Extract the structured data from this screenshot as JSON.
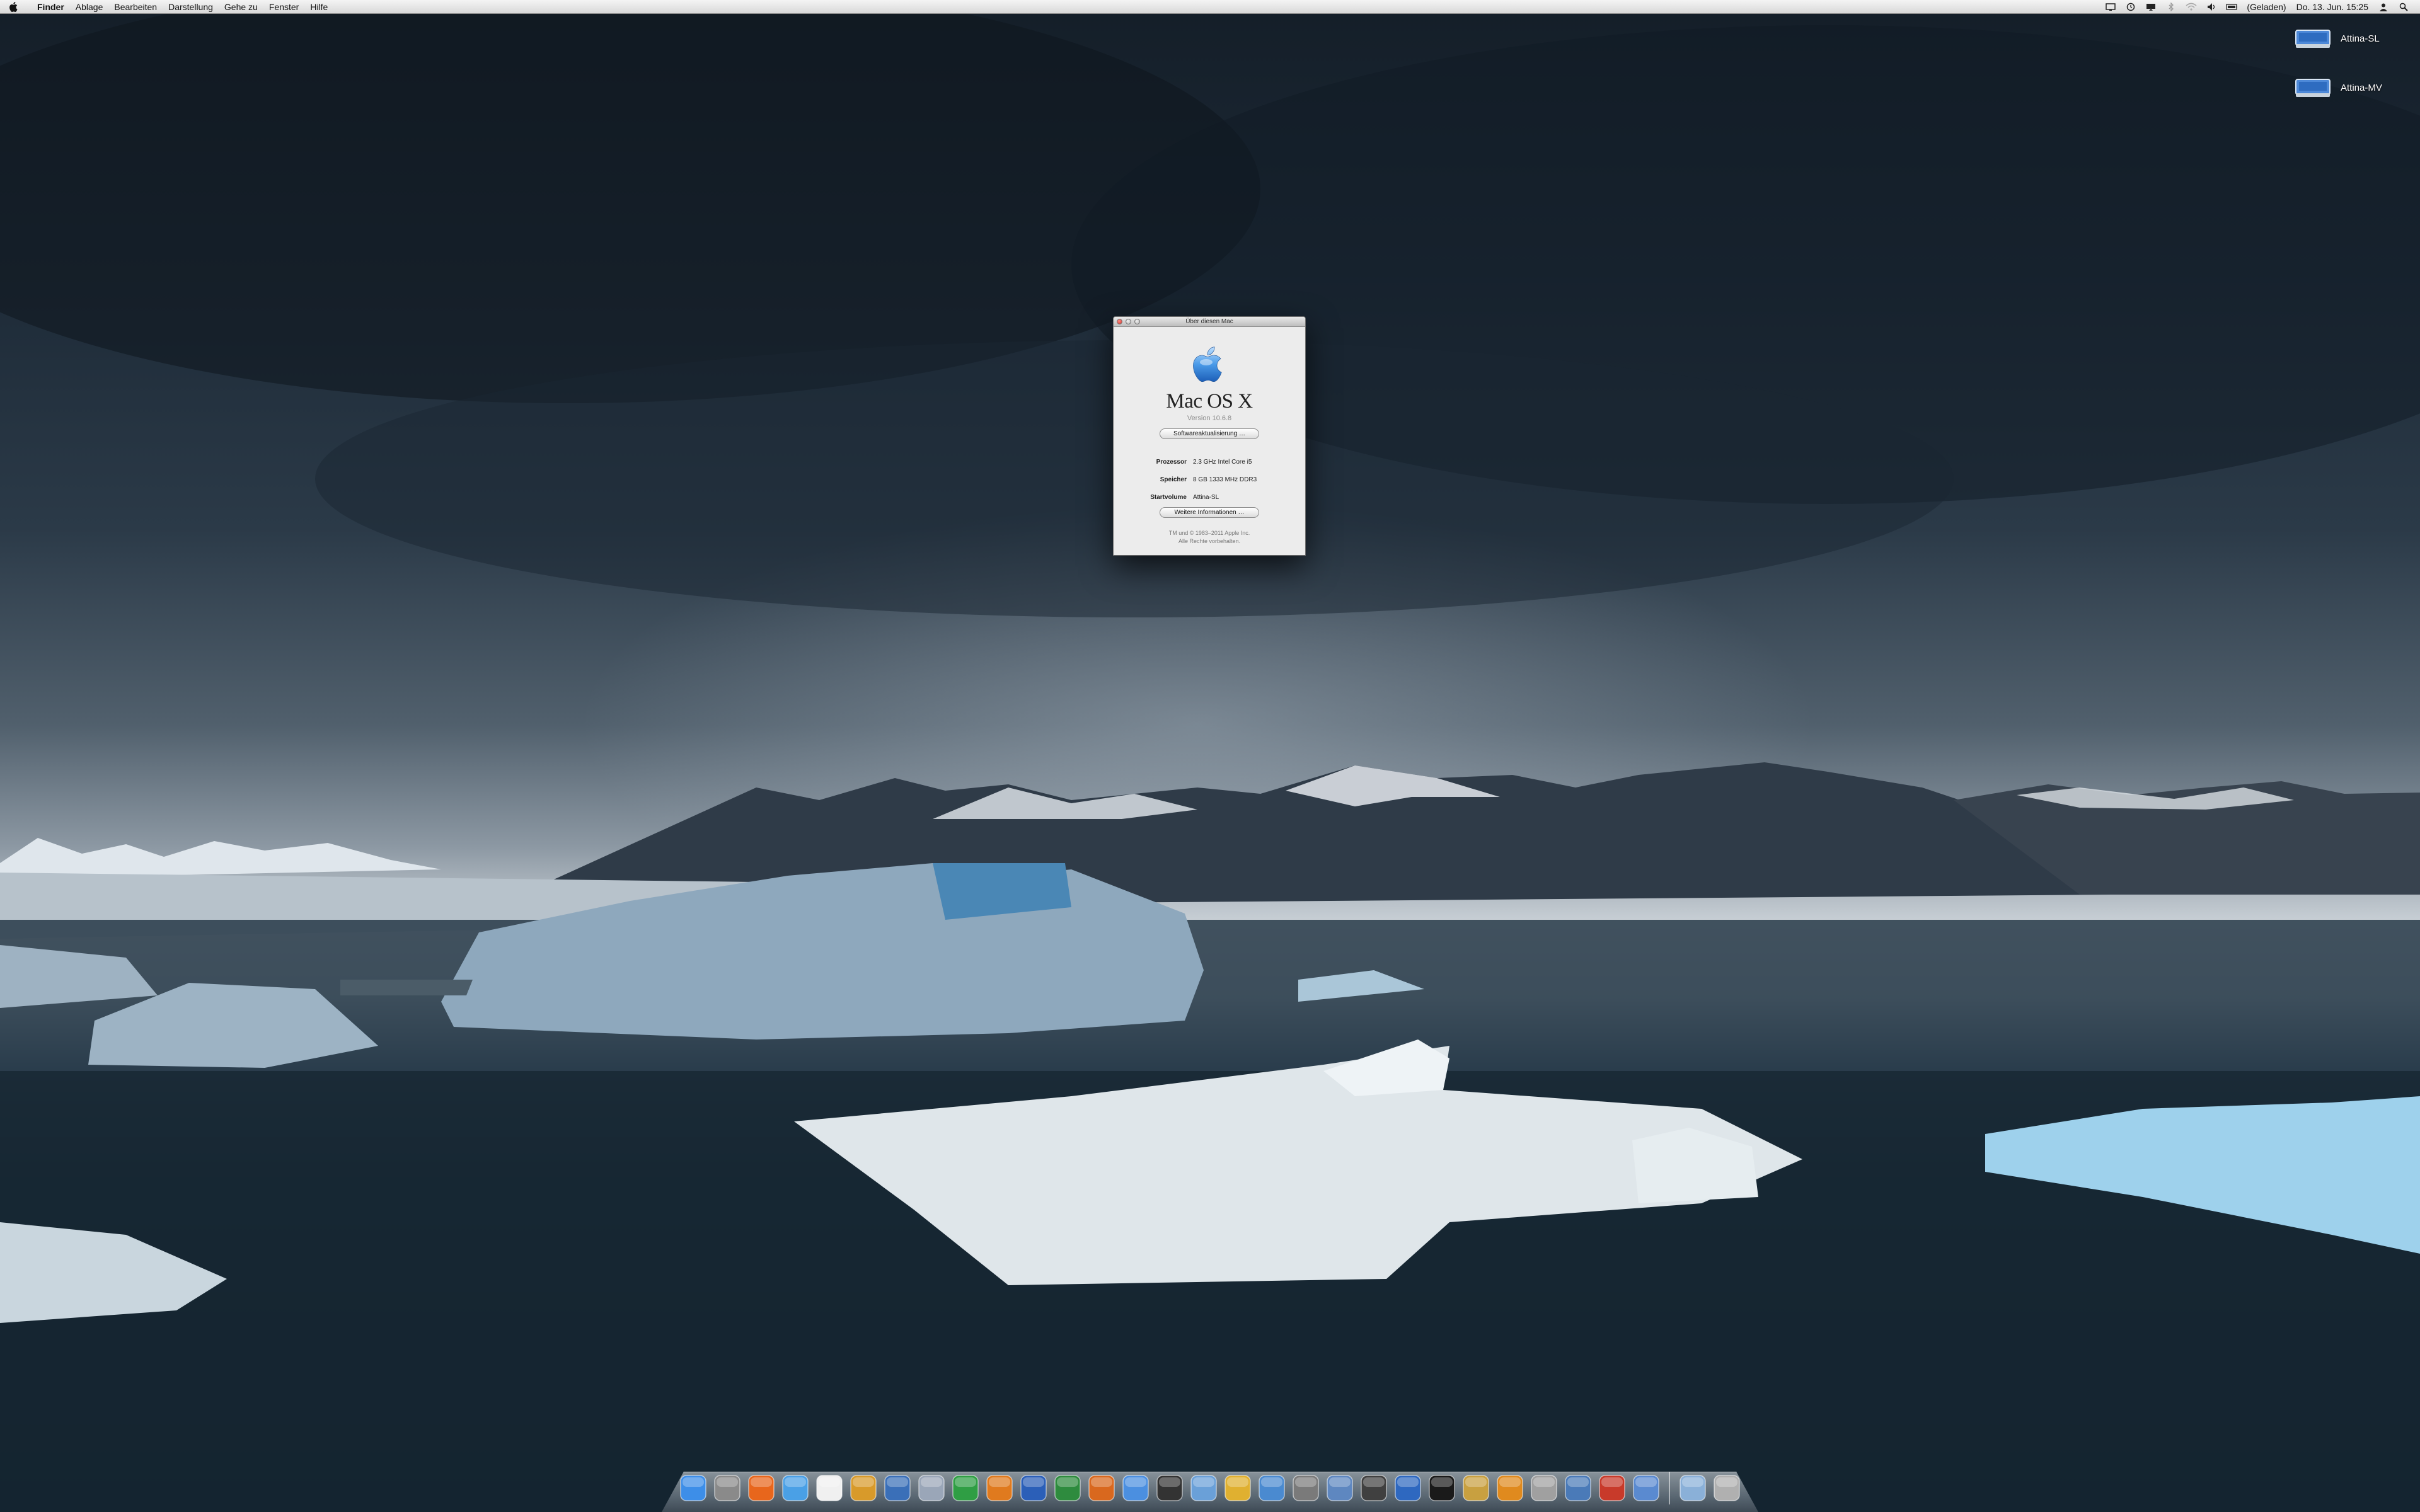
{
  "menubar": {
    "items": [
      "Finder",
      "Ablage",
      "Bearbeiten",
      "Darstellung",
      "Gehe zu",
      "Fenster",
      "Hilfe"
    ],
    "battery_label": "(Geladen)",
    "clock": "Do. 13. Jun. 15:25",
    "status_icons": [
      "display-icon",
      "timemachine-icon",
      "airplay-icon",
      "bluetooth-icon",
      "wifi-icon",
      "volume-icon",
      "battery-icon",
      "user-icon",
      "spotlight-icon"
    ]
  },
  "desktop": {
    "icons": [
      {
        "label": "Attina-SL",
        "icon": "hard-drive-icon"
      },
      {
        "label": "Attina-MV",
        "icon": "hard-drive-icon"
      }
    ]
  },
  "about_window": {
    "title": "Über diesen Mac",
    "os_name": "Mac OS X",
    "version": "Version 10.6.8",
    "update_button": "Softwareaktualisierung …",
    "specs": [
      {
        "key": "Prozessor",
        "value": "2.3 GHz Intel Core i5"
      },
      {
        "key": "Speicher",
        "value": "8 GB 1333 MHz DDR3"
      },
      {
        "key": "Startvolume",
        "value": "Attina-SL"
      }
    ],
    "more_button": "Weitere Informationen …",
    "copyright_line1": "TM und © 1983–2011 Apple Inc.",
    "copyright_line2": "Alle Rechte vorbehalten."
  },
  "dock": {
    "apps": [
      {
        "name": "finder",
        "color": "#3d8ee8"
      },
      {
        "name": "system-preferences",
        "color": "#8a8a8a"
      },
      {
        "name": "firefox",
        "color": "#e8661c"
      },
      {
        "name": "mail",
        "color": "#4aa0e6"
      },
      {
        "name": "textedit",
        "color": "#f0f0f0"
      },
      {
        "name": "preview",
        "color": "#d89a2a"
      },
      {
        "name": "istat",
        "color": "#3a6fb8"
      },
      {
        "name": "script-editor",
        "color": "#9aa6b8"
      },
      {
        "name": "numbers",
        "color": "#2f9e44"
      },
      {
        "name": "keynote",
        "color": "#e07a1e"
      },
      {
        "name": "word",
        "color": "#2b5fb8"
      },
      {
        "name": "excel",
        "color": "#2e8b3e"
      },
      {
        "name": "powerpoint",
        "color": "#d9681e"
      },
      {
        "name": "itunes",
        "color": "#4b8fe0"
      },
      {
        "name": "dvd-player",
        "color": "#333333"
      },
      {
        "name": "iphoto",
        "color": "#6aa0d8"
      },
      {
        "name": "photoshop",
        "color": "#e0b030"
      },
      {
        "name": "dashcode",
        "color": "#4a8ad0"
      },
      {
        "name": "automator",
        "color": "#7a7a7a"
      },
      {
        "name": "screen-sharing",
        "color": "#5e87c0"
      },
      {
        "name": "final-cut",
        "color": "#404040"
      },
      {
        "name": "r-project",
        "color": "#2e68c0"
      },
      {
        "name": "terminal",
        "color": "#1a1a1a"
      },
      {
        "name": "dictionary",
        "color": "#c8a040"
      },
      {
        "name": "pages",
        "color": "#e08a1e"
      },
      {
        "name": "photo-booth",
        "color": "#a0a0a0"
      },
      {
        "name": "virtualbox",
        "color": "#4a7ab8"
      },
      {
        "name": "parallels",
        "color": "#c83a2a"
      },
      {
        "name": "preview-window",
        "color": "#5a8ad0"
      }
    ],
    "stacks": [
      {
        "name": "documents-stack",
        "color": "#8ab0d8"
      },
      {
        "name": "trash",
        "color": "#b0b0b0"
      }
    ]
  }
}
